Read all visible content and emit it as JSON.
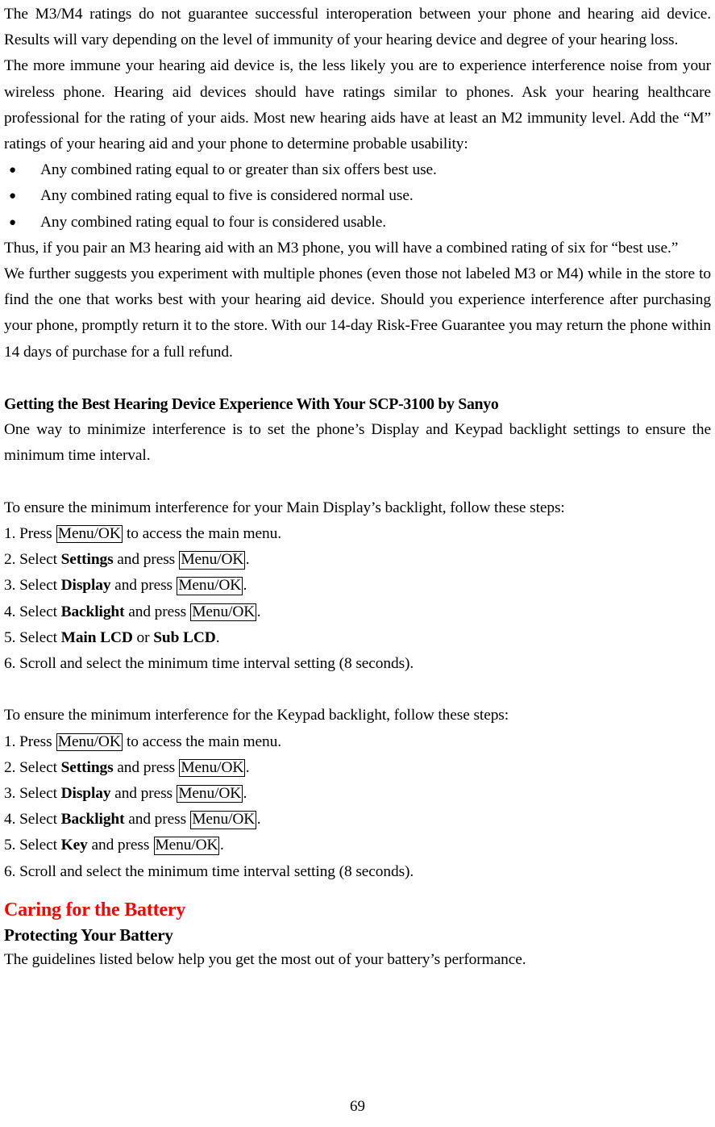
{
  "document": {
    "page_number": "69",
    "accent_color": "#FF0000",
    "body_color": "#000000"
  },
  "paragraphs": {
    "p1": "The M3/M4 ratings do not guarantee successful interoperation between your phone and hearing aid device. Results will vary depending on the level of immunity of your hearing device and degree of your hearing loss.",
    "p2": "The more immune your hearing aid device is, the less likely you are to experience interference noise from your wireless phone. Hearing aid devices should have ratings similar to phones. Ask your hearing healthcare professional for the rating of your aids. Most new hearing aids have at least an M2 immunity level. Add the “M” ratings of your hearing aid and your phone to determine probable usability:",
    "p3": "Thus, if you pair an M3 hearing aid with an M3 phone, you will have a combined rating of six for “best use.”",
    "p4": "We further suggests you experiment with multiple phones (even those not labeled M3 or M4) while in the store to find the one that works best with your hearing aid device. Should you experience interference after purchasing your phone, promptly return it to the store. With our 14-day Risk-Free Guarantee you may return the phone within 14 days of purchase for a full refund.",
    "p5": "One way to minimize interference is to set the phone’s Display and Keypad backlight settings to ensure the minimum time interval.",
    "p6": "The guidelines listed below help you get the most out of your battery’s performance."
  },
  "bullets": {
    "glyph": "●",
    "items": [
      "Any combined rating equal to or greater than six offers best use.",
      "Any combined rating equal to five is considered normal use.",
      "Any combined rating equal to four is considered usable."
    ]
  },
  "headings": {
    "sanyo_experience": "Getting the Best Hearing Device Experience With Your SCP-3100 by Sanyo",
    "caring_battery": "Caring for the Battery",
    "protecting_battery": "Protecting Your Battery"
  },
  "keycap": {
    "menu_ok": "Menu/OK"
  },
  "main_display": {
    "intro": "To ensure the minimum interference for your Main Display’s backlight, follow these steps:",
    "steps": [
      {
        "number": "1. ",
        "pre": "Press ",
        "key": "Menu/OK",
        "post": " to access the main menu."
      },
      {
        "number": "2. ",
        "pre": "Select ",
        "bold": "Settings",
        "mid": " and press ",
        "key": "Menu/OK",
        "post": "."
      },
      {
        "number": "3. ",
        "pre": "Select ",
        "bold": "Display",
        "mid": " and press ",
        "key": "Menu/OK",
        "post": "."
      },
      {
        "number": "4. ",
        "pre": "Select ",
        "bold": "Backlight",
        "mid": " and press ",
        "key": "Menu/OK",
        "post": "."
      },
      {
        "number": "5. ",
        "pre": "Select ",
        "bold": "Main LCD",
        "mid": " or ",
        "bold2": "Sub LCD",
        "post": "."
      },
      {
        "number": "6. ",
        "pre": "Scroll and select the minimum time interval setting (8 seconds)."
      }
    ]
  },
  "keypad": {
    "intro": "To ensure the minimum interference for the Keypad backlight, follow these steps:",
    "steps": [
      {
        "number": "1. ",
        "pre": "Press ",
        "key": "Menu/OK",
        "post": " to access the main menu."
      },
      {
        "number": "2. ",
        "pre": "Select ",
        "bold": "Settings",
        "mid": " and press ",
        "key": "Menu/OK",
        "post": "."
      },
      {
        "number": "3. ",
        "pre": "Select ",
        "bold": "Display",
        "mid": " and press ",
        "key": "Menu/OK",
        "post": "."
      },
      {
        "number": "4. ",
        "pre": "Select ",
        "bold": "Backlight",
        "mid": " and press ",
        "key": "Menu/OK",
        "post": "."
      },
      {
        "number": "5. ",
        "pre": "Select ",
        "bold": "Key",
        "mid": " and press ",
        "key": "Menu/OK",
        "post": "."
      },
      {
        "number": "6. ",
        "pre": "Scroll and select the minimum time interval setting (8 seconds)."
      }
    ]
  }
}
